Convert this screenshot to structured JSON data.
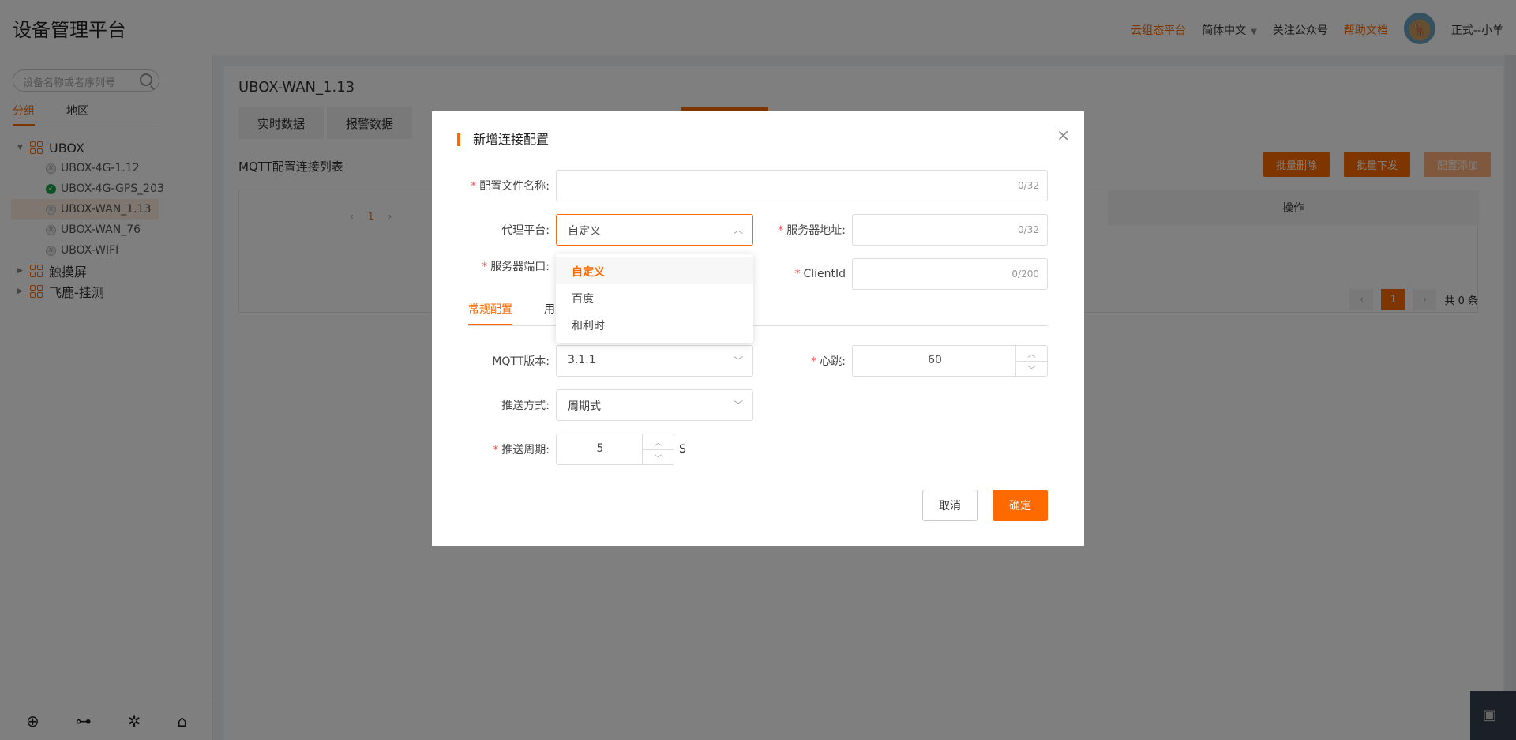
{
  "header": {
    "title": "设备管理平台",
    "cloud_platform": "云组态平台",
    "language": "简体中文",
    "follow": "关注公众号",
    "help": "帮助文档",
    "user": "正式--小羊"
  },
  "sidebar": {
    "search_placeholder": "设备名称或者序列号",
    "tabs": [
      "分组",
      "地区"
    ],
    "tree": {
      "group1": "UBOX",
      "devices": [
        "UBOX-4G-1.12",
        "UBOX-4G-GPS_203",
        "UBOX-WAN_1.13",
        "UBOX-WAN_76",
        "UBOX-WIFI"
      ],
      "group2": "触摸屏",
      "group3": "飞鹿-挂测"
    }
  },
  "main": {
    "device_title": "UBOX-WAN_1.13",
    "tabs": [
      "实时数据",
      "报警数据"
    ],
    "list_title": "MQTT配置连接列表",
    "actions": [
      "批量删除",
      "批量下发",
      "配置添加"
    ],
    "table_header_action": "操作",
    "mini_page": "1",
    "pager": {
      "current": "1",
      "total": "共 0 条"
    }
  },
  "dialog": {
    "title": "新增连接配置",
    "fields": {
      "config_name_label": "配置文件名称:",
      "config_name_count": "0/32",
      "proxy_label": "代理平台:",
      "proxy_value": "自定义",
      "server_addr_label": "服务器地址:",
      "server_addr_count": "0/32",
      "server_port_label": "服务器端口:",
      "client_id_label": "ClientId",
      "client_id_count": "0/200",
      "mqtt_version_label": "MQTT版本:",
      "mqtt_version_value": "3.1.1",
      "heartbeat_label": "心跳:",
      "heartbeat_value": "60",
      "push_mode_label": "推送方式:",
      "push_mode_value": "周期式",
      "push_period_label": "推送周期:",
      "push_period_value": "5",
      "push_period_unit": "S"
    },
    "proxy_options": [
      "自定义",
      "百度",
      "和利时"
    ],
    "tabs": [
      "常规配置",
      "用"
    ],
    "cancel": "取消",
    "confirm": "确定"
  }
}
